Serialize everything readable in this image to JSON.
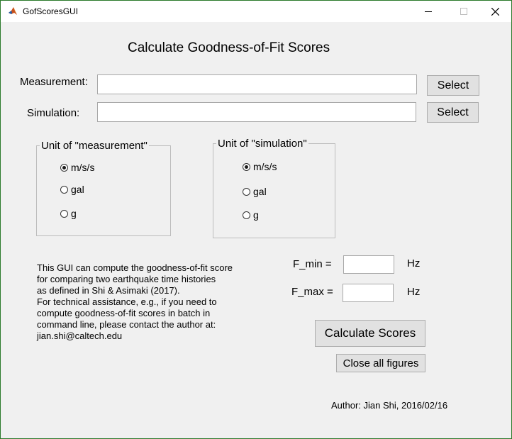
{
  "window": {
    "title": "GofScoresGUI",
    "icon": "matlab-icon",
    "controls": {
      "minimize": "minimize-icon",
      "maximize": "maximize-icon",
      "close": "close-icon"
    }
  },
  "heading": "Calculate Goodness-of-Fit Scores",
  "measurement": {
    "label": "Measurement:",
    "value": "",
    "button": "Select"
  },
  "simulation": {
    "label": "Simulation:",
    "value": "",
    "button": "Select"
  },
  "unit_measurement": {
    "title": "Unit of \"measurement\"",
    "options": [
      {
        "label": "m/s/s",
        "selected": true
      },
      {
        "label": "gal",
        "selected": false
      },
      {
        "label": "g",
        "selected": false
      }
    ]
  },
  "unit_simulation": {
    "title": "Unit of \"simulation\"",
    "options": [
      {
        "label": "m/s/s",
        "selected": true
      },
      {
        "label": "gal",
        "selected": false
      },
      {
        "label": "g",
        "selected": false
      }
    ]
  },
  "info": {
    "lines": [
      "This GUI can compute the goodness-of-fit score",
      "for comparing two earthquake time histories",
      "as defined in Shi & Asimaki (2017).",
      "For technical assistance, e.g., if you need to",
      "compute goodness-of-fit scores in batch in",
      "command line, please contact the author at:",
      "jian.shi@caltech.edu"
    ]
  },
  "fmin": {
    "label": "F_min =",
    "value": "",
    "unit": "Hz"
  },
  "fmax": {
    "label": "F_max =",
    "value": "",
    "unit": "Hz"
  },
  "buttons": {
    "calculate": "Calculate Scores",
    "close_figures": "Close all figures"
  },
  "author": "Author: Jian Shi, 2016/02/16"
}
